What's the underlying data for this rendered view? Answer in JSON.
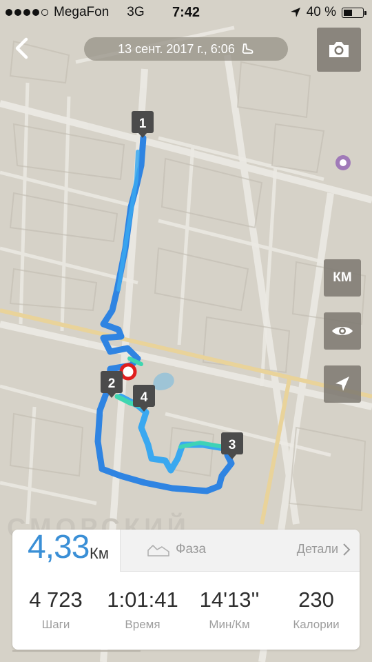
{
  "status_bar": {
    "carrier": "MegaFon",
    "network": "3G",
    "time": "7:42",
    "battery": "40 %"
  },
  "header": {
    "date_label": "13 сент. 2017 г., 6:06"
  },
  "map": {
    "markers": [
      "1",
      "2",
      "3",
      "4"
    ],
    "district_label": "СМОРСКИЙ",
    "route_colors": [
      "#2f84e2",
      "#3aa8f0",
      "#3fd6b0"
    ]
  },
  "controls": {
    "units_label": "КМ"
  },
  "summary": {
    "distance_value": "4,33",
    "distance_unit": "Км",
    "phase_label": "Фаза",
    "details_label": "Детали"
  },
  "stats": [
    {
      "value": "4 723",
      "label": "Шаги"
    },
    {
      "value": "1:01:41",
      "label": "Время"
    },
    {
      "value": "14'13''",
      "label": "Мин/Км"
    },
    {
      "value": "230",
      "label": "Калории"
    }
  ],
  "colors": {
    "accent": "#3a8fd6",
    "map_bg": "#d6d2c8",
    "road": "#e9d39a"
  }
}
